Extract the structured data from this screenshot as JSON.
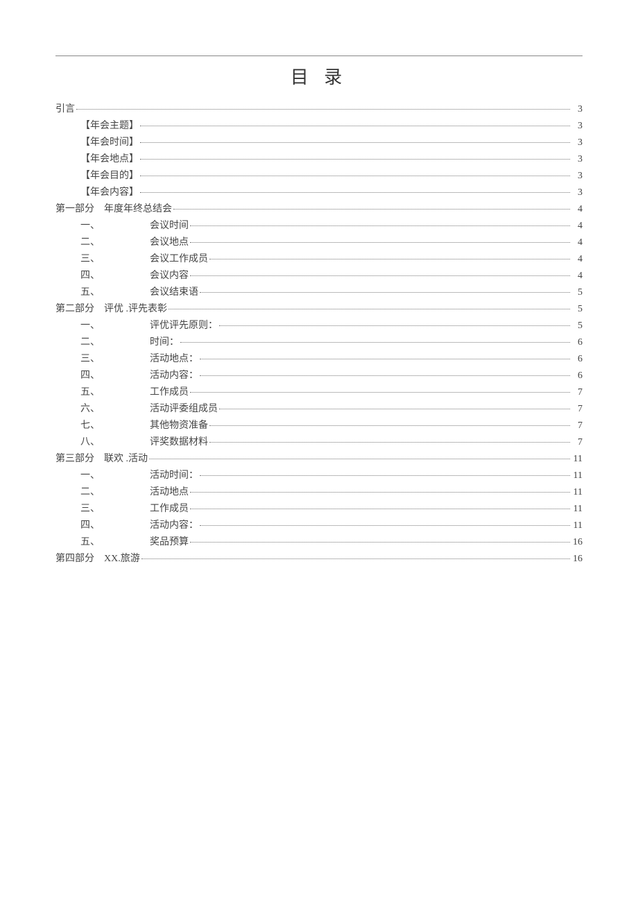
{
  "title": "目 录",
  "toc": [
    {
      "level": 0,
      "prefix": "",
      "label": "引言",
      "page": "3"
    },
    {
      "level": 1,
      "prefix": "",
      "label": "【年会主题】",
      "page": "3"
    },
    {
      "level": 1,
      "prefix": "",
      "label": "【年会时间】",
      "page": "3"
    },
    {
      "level": 1,
      "prefix": "",
      "label": "【年会地点】",
      "page": "3"
    },
    {
      "level": 1,
      "prefix": "",
      "label": "【年会目的】",
      "page": "3"
    },
    {
      "level": 1,
      "prefix": "",
      "label": "【年会内容】",
      "page": "3"
    },
    {
      "level": 0,
      "prefix": "第一部分",
      "label": "年度年终总结会",
      "page": "4"
    },
    {
      "level": 2,
      "prefix": "一、",
      "label": "会议时间",
      "page": "4"
    },
    {
      "level": 2,
      "prefix": "二、",
      "label": "会议地点",
      "page": "4"
    },
    {
      "level": 2,
      "prefix": "三、",
      "label": "会议工作成员",
      "page": "4"
    },
    {
      "level": 2,
      "prefix": "四、",
      "label": "会议内容",
      "page": "4"
    },
    {
      "level": 2,
      "prefix": "五、",
      "label": "会议结束语",
      "page": "5"
    },
    {
      "level": 0,
      "prefix": "第二部分",
      "label": "评优 .评先表彰",
      "page": "5"
    },
    {
      "level": 2,
      "prefix": "一、",
      "label": "评优评先原则：",
      "page": "5"
    },
    {
      "level": 2,
      "prefix": "二、",
      "label": "时间：",
      "page": "6"
    },
    {
      "level": 2,
      "prefix": "三、",
      "label": "活动地点：",
      "page": "6"
    },
    {
      "level": 2,
      "prefix": "四、",
      "label": "活动内容：",
      "page": "6"
    },
    {
      "level": 2,
      "prefix": "五、",
      "label": "工作成员",
      "page": "7"
    },
    {
      "level": 2,
      "prefix": "六、",
      "label": "活动评委组成员",
      "page": "7"
    },
    {
      "level": 2,
      "prefix": "七、",
      "label": "其他物资准备",
      "page": "7"
    },
    {
      "level": 2,
      "prefix": "八、",
      "label": "评奖数据材料",
      "page": "7"
    },
    {
      "level": 0,
      "prefix": "第三部分",
      "label": "联欢 .活动",
      "page": "11"
    },
    {
      "level": 2,
      "prefix": "一、",
      "label": "活动时间：",
      "page": "11"
    },
    {
      "level": 2,
      "prefix": "二、",
      "label": "活动地点",
      "page": "11"
    },
    {
      "level": 2,
      "prefix": "三、",
      "label": "工作成员",
      "page": "11"
    },
    {
      "level": 2,
      "prefix": "四、",
      "label": "活动内容：",
      "page": "11"
    },
    {
      "level": 2,
      "prefix": "五、",
      "label": "奖品预算",
      "page": "16"
    },
    {
      "level": 0,
      "prefix": "第四部分",
      "label": "XX.旅游",
      "page": "16"
    }
  ]
}
